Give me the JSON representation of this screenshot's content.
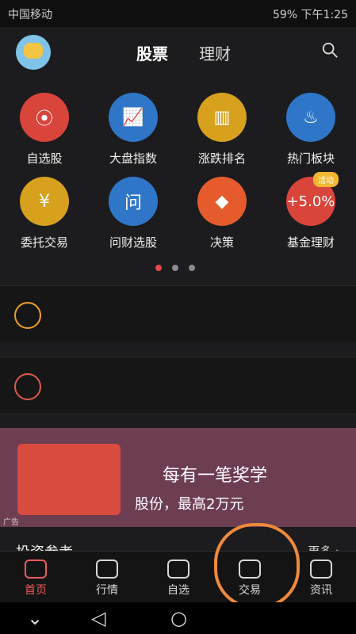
{
  "status": {
    "left": "中国移动 ",
    "right": "59%  下午1:25"
  },
  "header": {
    "tabs": [
      "股票",
      "理财"
    ]
  },
  "grid": {
    "items": [
      {
        "label": "自选股",
        "color": "#d9443b",
        "icon": "person-icon"
      },
      {
        "label": "大盘指数",
        "color": "#2f76c8",
        "icon": "chart-icon"
      },
      {
        "label": "涨跌排名",
        "color": "#d7a11e",
        "icon": "bars-icon"
      },
      {
        "label": "热门板块",
        "color": "#2f76c8",
        "icon": "flame-icon"
      },
      {
        "label": "委托交易",
        "color": "#d7a11e",
        "icon": "yen-icon"
      },
      {
        "label": "问财选股",
        "color": "#2f76c8",
        "icon": "question-icon"
      },
      {
        "label": "决策",
        "color": "#e65b2c",
        "icon": "diamond-icon"
      },
      {
        "label": "基金理财",
        "color": "#d9443b",
        "icon": "percent-icon",
        "text": "+5.0%",
        "badge": "活动"
      }
    ]
  },
  "cards": [
    {
      "text": ""
    },
    {
      "text": ""
    }
  ],
  "banner": {
    "t1": "每有一笔奖学",
    "t2": "股份，最高2万元",
    "ad": "广告"
  },
  "section": {
    "title": "投资参考",
    "more": "更多 ›"
  },
  "bottom": {
    "items": [
      {
        "label": "首页",
        "active": true
      },
      {
        "label": "行情",
        "active": false
      },
      {
        "label": "自选",
        "active": false
      },
      {
        "label": "交易",
        "active": false
      },
      {
        "label": "资讯",
        "active": false
      }
    ]
  },
  "nav": {
    "back": "◁",
    "home": "○",
    "recent": "⌄"
  }
}
